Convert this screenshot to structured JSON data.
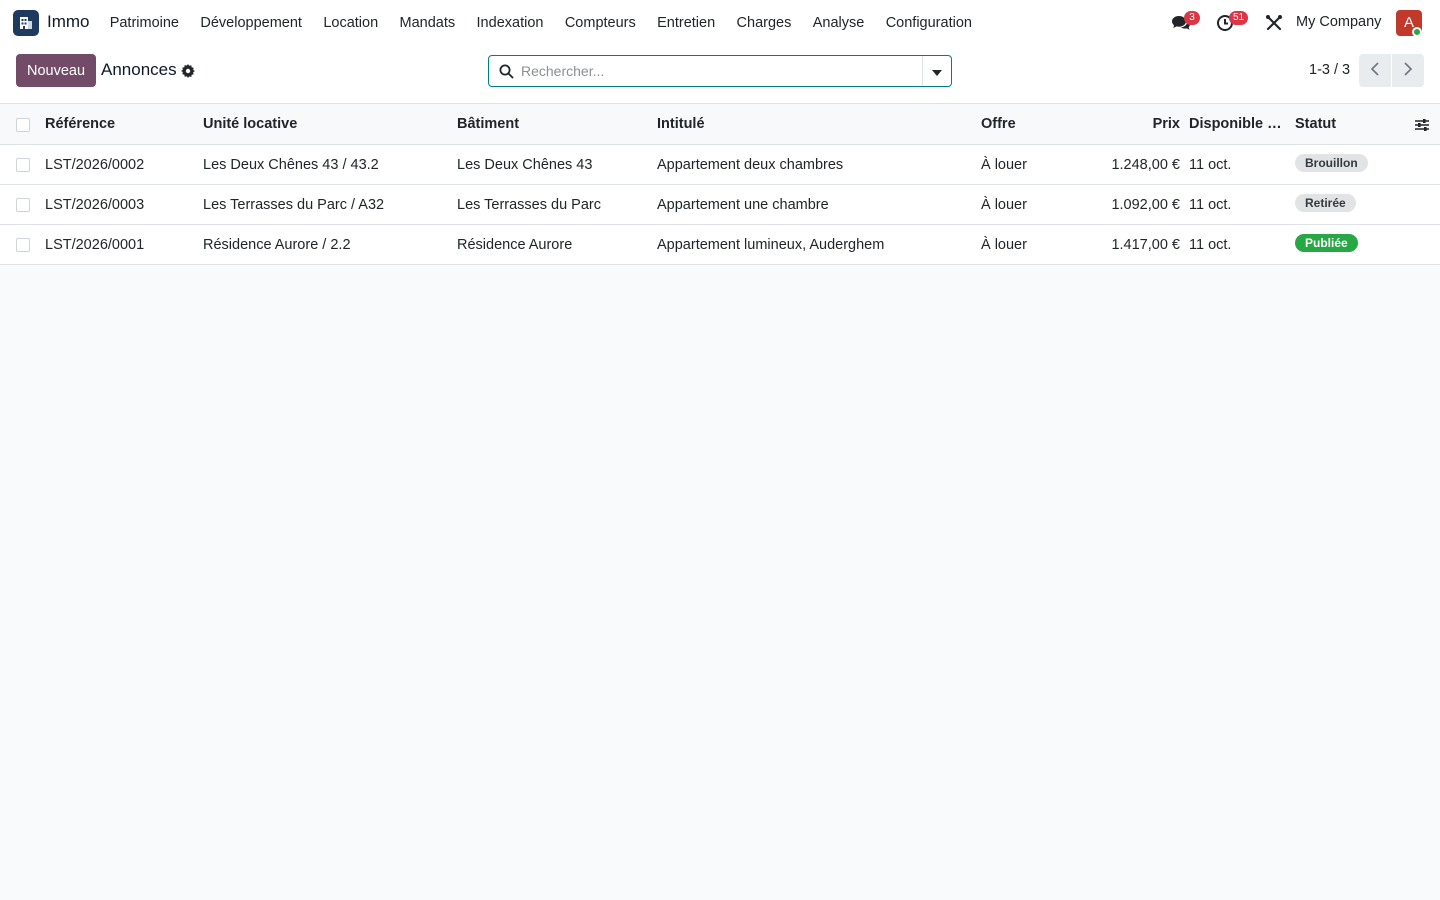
{
  "app": {
    "name": "Immo",
    "icon": "building-icon"
  },
  "menu": [
    {
      "id": "patrimoine",
      "label": "Patrimoine"
    },
    {
      "id": "developpement",
      "label": "Développement"
    },
    {
      "id": "location",
      "label": "Location"
    },
    {
      "id": "mandats",
      "label": "Mandats"
    },
    {
      "id": "indexation",
      "label": "Indexation"
    },
    {
      "id": "compteurs",
      "label": "Compteurs"
    },
    {
      "id": "entretien",
      "label": "Entretien"
    },
    {
      "id": "charges",
      "label": "Charges"
    },
    {
      "id": "analyse",
      "label": "Analyse"
    },
    {
      "id": "configuration",
      "label": "Configuration"
    }
  ],
  "systray": {
    "messages_count": "3",
    "activities_count": "51",
    "company": "My Company",
    "avatar_initial": "A",
    "avatar_color": "#c0392b"
  },
  "control": {
    "new_label": "Nouveau",
    "title": "Annonces",
    "search_placeholder": "Rechercher...",
    "pager": "1-3 / 3"
  },
  "list": {
    "columns": {
      "ref": "Référence",
      "unit": "Unité locative",
      "building": "Bâtiment",
      "title": "Intitulé",
      "offer": "Offre",
      "price": "Prix",
      "available": "Disponible à ...",
      "status": "Statut"
    },
    "rows": [
      {
        "ref": "LST/2026/0002",
        "unit": "Les Deux Chênes 43 / 43.2",
        "building": "Les Deux Chênes 43",
        "title": "Appartement deux chambres",
        "offer": "À louer",
        "price": "1.248,00 €",
        "available": "11 oct.",
        "status": "Brouillon"
      },
      {
        "ref": "LST/2026/0003",
        "unit": "Les Terrasses du Parc / A32",
        "building": "Les Terrasses du Parc",
        "title": "Appartement une chambre",
        "offer": "À louer",
        "price": "1.092,00 €",
        "available": "11 oct.",
        "status": "Retirée"
      },
      {
        "ref": "LST/2026/0001",
        "unit": "Résidence Aurore / 2.2",
        "building": "Résidence Aurore",
        "title": "Appartement lumineux, Auderghem",
        "offer": "À louer",
        "price": "1.417,00 €",
        "available": "11 oct.",
        "status": "Publiée"
      }
    ]
  },
  "colors": {
    "brand": "#714b67",
    "search_border": "#017e84",
    "badge_red": "#dc3545",
    "status_published": "#28a745",
    "status_neutral": "#e2e3e5"
  }
}
